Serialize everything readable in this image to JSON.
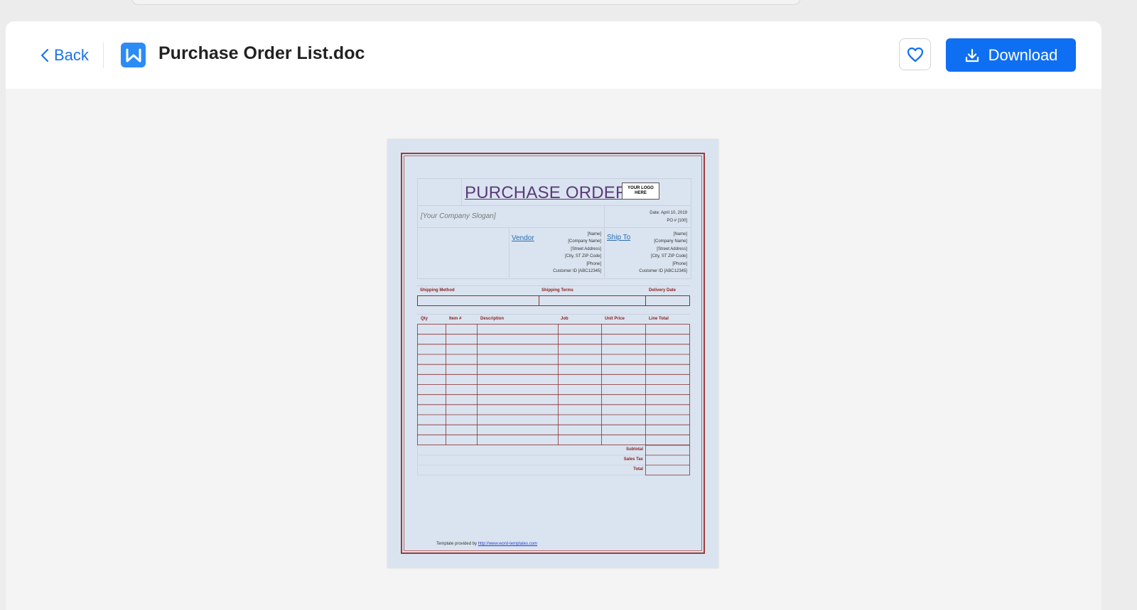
{
  "header": {
    "back_label": "Back",
    "file_title": "Purchase Order List.doc",
    "download_label": "Download"
  },
  "icons": {
    "back": "chevron-left-icon",
    "app": "wps-writer-icon",
    "favorite": "heart-icon",
    "download": "download-icon"
  },
  "colors": {
    "accent": "#0f6ff2",
    "doc_background": "#dae4f0",
    "doc_border": "#9b3b3b",
    "doc_title": "#5b3a78"
  },
  "document": {
    "title": "PURCHASE ORDER",
    "logo_text": "YOUR LOGO HERE",
    "slogan": "[Your Company Slogan]",
    "date": "Date: April 10, 2019",
    "po_number": "PO # [100]",
    "vendor_label": "Vendor",
    "ship_to_label": "Ship To",
    "vendor_lines": [
      "[Name]",
      "[Company Name]",
      "[Street Address]",
      "[City, ST ZIP Code]",
      "[Phone]",
      "Customer ID [ABC12345]"
    ],
    "ship_to_lines": [
      "[Name]",
      "[Company Name]",
      "[Street Address]",
      "[City, ST ZIP Code]",
      "[Phone]",
      "Customer ID [ABC12345]"
    ],
    "shipping_headers": [
      "Shipping Method",
      "Shipping Terms",
      "Delivery Date"
    ],
    "item_headers": [
      "Qty",
      "Item #",
      "Description",
      "Job",
      "Unit Price",
      "Line Total"
    ],
    "totals": [
      "Subtotal",
      "Sales Tax",
      "Total"
    ],
    "footer_text": "Template provided by",
    "footer_link": "http://www.word-templates.com"
  }
}
